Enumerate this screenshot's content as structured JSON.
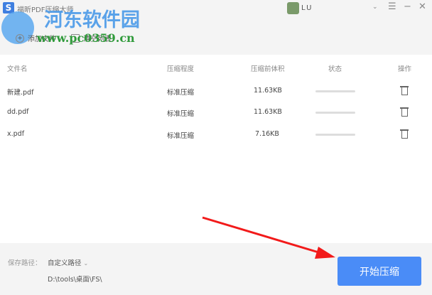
{
  "app": {
    "title": "福昕PDF压缩大师",
    "user": "LU"
  },
  "toolbar": {
    "add_files": "添加文件",
    "clear_list": "清空列表"
  },
  "watermark": {
    "name": "河东软件园",
    "url": "www.pc0359.cn"
  },
  "table": {
    "headers": [
      "文件名",
      "压缩程度",
      "压缩前体积",
      "状态",
      "操作"
    ],
    "rows": [
      {
        "name": "新建.pdf",
        "level": "标准压缩",
        "size": "11.63KB",
        "progress": 0
      },
      {
        "name": "dd.pdf",
        "level": "标准压缩",
        "size": "11.63KB",
        "progress": 0
      },
      {
        "name": "x.pdf",
        "level": "标准压缩",
        "size": "7.16KB",
        "progress": 0
      }
    ]
  },
  "footer": {
    "save_path_label": "保存路径：",
    "save_mode": "自定义路径",
    "path": "D:\\tools\\桌面\\FS\\",
    "start": "开始压缩"
  },
  "colors": {
    "accent": "#4a8cf7",
    "arrow": "#f21a1a"
  }
}
